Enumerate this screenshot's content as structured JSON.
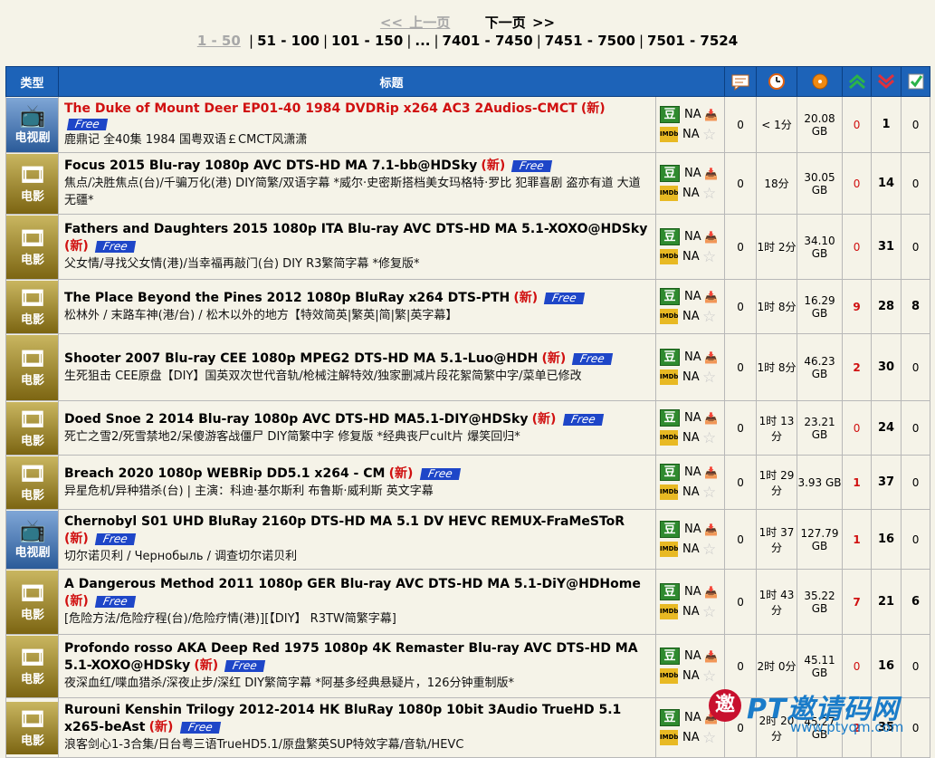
{
  "pager": {
    "prev": "<< 上一页",
    "next": "下一页 >>",
    "current": "1 - 50",
    "pages": [
      "51 - 100",
      "101 - 150",
      "...",
      "7401 - 7450",
      "7451 - 7500",
      "7501 - 7524"
    ]
  },
  "header": {
    "type": "类型",
    "title": "标题"
  },
  "common": {
    "na": "NA",
    "douban": "豆",
    "imdb": "IMDb",
    "new": "新",
    "free": "Free"
  },
  "rows": [
    {
      "cat": "电视剧",
      "title": "The Duke of Mount Deer EP01-40 1984 DVDRip x264 AC3 2Audios-CMCT",
      "sub": "鹿鼎记 全40集 1984 国粤双语￡CMCT风潇潇",
      "comments": "0",
      "age": "< 1分",
      "size": "20.08 GB",
      "seed": "0",
      "leech": "1",
      "done": "0"
    },
    {
      "cat": "电影",
      "title": "Focus 2015 Blu-ray 1080p AVC DTS-HD MA 7.1-bb@HDSky",
      "sub": "焦点/决胜焦点(台)/千骗万化(港) DIY简繁/双语字幕 *威尔·史密斯搭档美女玛格特·罗比 犯罪喜剧 盗亦有道 大道无疆*",
      "comments": "0",
      "age": "18分",
      "size": "30.05 GB",
      "seed": "0",
      "leech": "14",
      "done": "0"
    },
    {
      "cat": "电影",
      "title": "Fathers and Daughters 2015 1080p ITA Blu-ray AVC DTS-HD MA 5.1-XOXO@HDSky",
      "sub": "父女情/寻找父女情(港)/当幸福再敲门(台) DIY R3繁简字幕 *修复版*",
      "comments": "0",
      "age": "1时 2分",
      "size": "34.10 GB",
      "seed": "0",
      "leech": "31",
      "done": "0"
    },
    {
      "cat": "电影",
      "title": "The Place Beyond the Pines 2012 1080p BluRay x264 DTS-PTH",
      "sub": "松林外 / 末路车神(港/台) / 松木以外的地方【特效简英|繁英|简|繁|英字幕】",
      "comments": "0",
      "age": "1时 8分",
      "size": "16.29 GB",
      "seed": "9",
      "leech": "28",
      "done": "8"
    },
    {
      "cat": "电影",
      "title": "Shooter 2007 Blu-ray CEE 1080p MPEG2 DTS-HD MA 5.1-Luo@HDH",
      "sub": "生死狙击 CEE原盘【DIY】国英双次世代音轨/枪械注解特效/独家删减片段花絮简繁中字/菜单已修改",
      "comments": "0",
      "age": "1时 8分",
      "size": "46.23 GB",
      "seed": "2",
      "leech": "30",
      "done": "0"
    },
    {
      "cat": "电影",
      "title": "Doed Snoe 2 2014 Blu-ray 1080p AVC DTS-HD MA5.1-DIY@HDSky",
      "sub": "死亡之雪2/死雪禁地2/呆傻游客战僵尸 DIY简繁中字 修复版 *经典丧尸cult片 爆笑回归*",
      "comments": "0",
      "age": "1时 13分",
      "size": "23.21 GB",
      "seed": "0",
      "leech": "24",
      "done": "0"
    },
    {
      "cat": "电影",
      "title": "Breach 2020 1080p WEBRip DD5.1 x264 - CM",
      "sub": "异星危机/异种猎杀(台) | 主演：科迪·基尔斯利 布鲁斯·威利斯 英文字幕",
      "comments": "0",
      "age": "1时 29分",
      "size": "3.93 GB",
      "seed": "1",
      "leech": "37",
      "done": "0"
    },
    {
      "cat": "电视剧",
      "title": "Chernobyl S01 UHD BluRay 2160p DTS-HD MA 5.1 DV HEVC REMUX-FraMeSToR",
      "sub": "切尔诺贝利 / Чернобыль / 调查切尔诺贝利",
      "comments": "0",
      "age": "1时 37分",
      "size": "127.79 GB",
      "seed": "1",
      "leech": "16",
      "done": "0"
    },
    {
      "cat": "电影",
      "title": "A Dangerous Method 2011 1080p GER Blu-ray AVC DTS-HD MA 5.1-DiY@HDHome",
      "sub": "[危险方法/危险疗程(台)/危险疗情(港)][【DIY】 R3TW简繁字幕]",
      "comments": "0",
      "age": "1时 43分",
      "size": "35.22 GB",
      "seed": "7",
      "leech": "21",
      "done": "6"
    },
    {
      "cat": "电影",
      "title": "Profondo rosso AKA Deep Red 1975 1080p 4K Remaster Blu-ray AVC DTS-HD MA 5.1-XOXO@HDSky",
      "sub": "夜深血红/喋血猎杀/深夜止步/深红 DIY繁简字幕 *阿基多经典悬疑片，126分钟重制版*",
      "comments": "0",
      "age": "2时 0分",
      "size": "45.11 GB",
      "seed": "0",
      "leech": "16",
      "done": "0"
    },
    {
      "cat": "电影",
      "title": "Rurouni Kenshin Trilogy 2012-2014 HK BluRay 1080p 10bit 3Audio TrueHD 5.1 x265-beAst",
      "sub": "浪客剑心1-3合集/日台粤三语TrueHD5.1/原盘繁英SUP特效字幕/音轨/HEVC",
      "comments": "0",
      "age": "2时 20分",
      "size": "45.27 GB",
      "seed": "2",
      "leech": "35",
      "done": "0"
    }
  ],
  "watermark": {
    "logo": "邀",
    "text": "PT邀请码网",
    "url": "www.ptyqm.com"
  }
}
